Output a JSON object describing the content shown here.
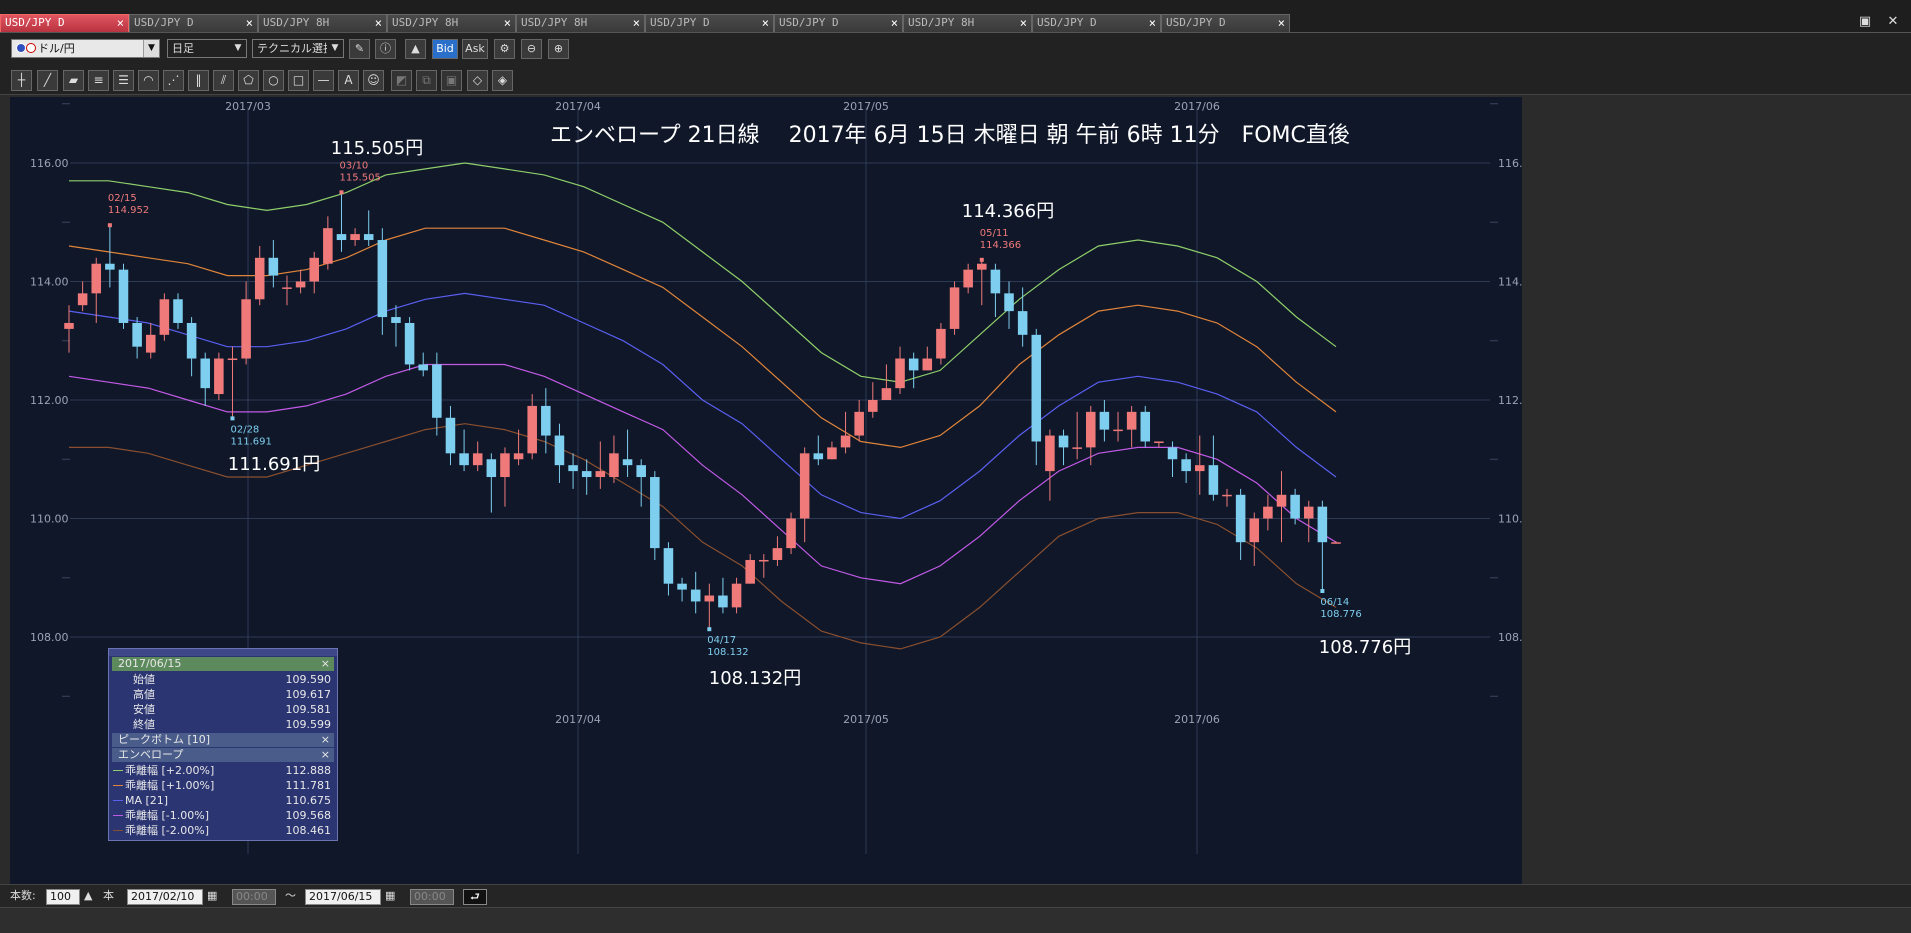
{
  "tabs": [
    {
      "label": "USD/JPY D",
      "active": true
    },
    {
      "label": "USD/JPY D",
      "active": false
    },
    {
      "label": "USD/JPY 8H",
      "active": false
    },
    {
      "label": "USD/JPY 8H",
      "active": false
    },
    {
      "label": "USD/JPY 8H",
      "active": false
    },
    {
      "label": "USD/JPY D",
      "active": false
    },
    {
      "label": "USD/JPY D",
      "active": false
    },
    {
      "label": "USD/JPY 8H",
      "active": false
    },
    {
      "label": "USD/JPY D",
      "active": false
    },
    {
      "label": "USD/JPY D",
      "active": false
    }
  ],
  "tab_close": "×",
  "window_buttons": [
    "▣",
    "✕"
  ],
  "toolbar": {
    "pair": "ドル/円",
    "timeframe": "日足",
    "technical": "テクニカル選択",
    "bid": "Bid",
    "ask": "Ask"
  },
  "chart": {
    "annotation": "エンベロープ 21日線　 2017年 6月 15日 木曜日 朝 午前 6時 11分　FOMC直後",
    "month_labels": [
      "2017/03",
      "2017/04",
      "2017/05",
      "2017/06"
    ],
    "y_labels": [
      "116.00",
      "114.00",
      "112.00",
      "110.00",
      "108.00"
    ],
    "price_callouts": [
      {
        "text": "115.505円"
      },
      {
        "text": "111.691円"
      },
      {
        "text": "114.366円"
      },
      {
        "text": "108.132円"
      },
      {
        "text": "108.776円"
      }
    ],
    "peak_labels": [
      {
        "date": "02/15",
        "price": "114.952",
        "kind": "high"
      },
      {
        "date": "03/10",
        "price": "115.505",
        "kind": "high"
      },
      {
        "date": "05/11",
        "price": "114.366",
        "kind": "high"
      },
      {
        "date": "02/28",
        "price": "111.691",
        "kind": "low"
      },
      {
        "date": "04/17",
        "price": "108.132",
        "kind": "low"
      },
      {
        "date": "06/14",
        "price": "108.776",
        "kind": "low"
      }
    ],
    "colors": {
      "up": "#f07a7a",
      "down": "#7ecfef",
      "plus2": "#8fcf6a",
      "plus1": "#e0843a",
      "ma": "#5a5ff0",
      "minus1": "#c25ae6",
      "minus2": "#8a4f2e"
    }
  },
  "chart_data": {
    "type": "candlestick",
    "ylim": [
      106.6,
      117.8
    ],
    "candles": [
      [
        113.2,
        113.3,
        112.8,
        113.6
      ],
      [
        113.6,
        113.8,
        113.5,
        114.0
      ],
      [
        113.8,
        114.3,
        113.3,
        114.4
      ],
      [
        114.3,
        114.2,
        113.9,
        114.95
      ],
      [
        114.2,
        113.3,
        113.2,
        114.3
      ],
      [
        113.3,
        112.9,
        112.7,
        113.4
      ],
      [
        112.8,
        113.1,
        112.7,
        113.3
      ],
      [
        113.1,
        113.7,
        113.0,
        113.8
      ],
      [
        113.7,
        113.3,
        113.2,
        113.8
      ],
      [
        113.3,
        112.7,
        112.4,
        113.4
      ],
      [
        112.7,
        112.2,
        111.9,
        112.8
      ],
      [
        112.1,
        112.7,
        112.0,
        112.8
      ],
      [
        112.7,
        112.7,
        111.69,
        112.9
      ],
      [
        112.7,
        113.7,
        112.6,
        114.0
      ],
      [
        113.7,
        114.4,
        113.6,
        114.6
      ],
      [
        114.4,
        114.1,
        113.9,
        114.7
      ],
      [
        113.9,
        113.9,
        113.6,
        114.1
      ],
      [
        113.9,
        114.0,
        113.8,
        114.2
      ],
      [
        114.0,
        114.4,
        113.8,
        114.5
      ],
      [
        114.3,
        114.9,
        114.2,
        115.1
      ],
      [
        114.8,
        114.7,
        114.5,
        115.505
      ],
      [
        114.7,
        114.8,
        114.6,
        114.9
      ],
      [
        114.8,
        114.7,
        114.6,
        115.2
      ],
      [
        114.7,
        113.4,
        113.1,
        114.9
      ],
      [
        113.4,
        113.3,
        112.9,
        113.6
      ],
      [
        113.3,
        112.6,
        112.5,
        113.4
      ],
      [
        112.6,
        112.5,
        112.4,
        112.8
      ],
      [
        112.6,
        111.7,
        111.4,
        112.8
      ],
      [
        111.7,
        111.1,
        110.9,
        111.9
      ],
      [
        111.1,
        110.9,
        110.8,
        111.5
      ],
      [
        110.9,
        111.1,
        110.8,
        111.3
      ],
      [
        111.0,
        110.7,
        110.1,
        111.1
      ],
      [
        110.7,
        111.1,
        110.2,
        111.2
      ],
      [
        111.0,
        111.1,
        110.9,
        111.5
      ],
      [
        111.1,
        111.9,
        111.0,
        112.1
      ],
      [
        111.9,
        111.4,
        111.1,
        112.2
      ],
      [
        111.4,
        110.9,
        110.6,
        111.6
      ],
      [
        110.9,
        110.8,
        110.5,
        111.1
      ],
      [
        110.8,
        110.7,
        110.4,
        111.0
      ],
      [
        110.7,
        110.8,
        110.5,
        111.3
      ],
      [
        110.7,
        111.1,
        110.6,
        111.4
      ],
      [
        111.0,
        110.9,
        110.7,
        111.5
      ],
      [
        110.9,
        110.7,
        110.2,
        111.0
      ],
      [
        110.7,
        109.5,
        109.3,
        110.8
      ],
      [
        109.5,
        108.9,
        108.7,
        109.6
      ],
      [
        108.9,
        108.8,
        108.6,
        109.0
      ],
      [
        108.8,
        108.6,
        108.4,
        109.1
      ],
      [
        108.6,
        108.7,
        108.132,
        108.9
      ],
      [
        108.7,
        108.5,
        108.4,
        109.0
      ],
      [
        108.5,
        108.9,
        108.4,
        109.0
      ],
      [
        108.9,
        109.3,
        108.9,
        109.4
      ],
      [
        109.3,
        109.3,
        109.0,
        109.4
      ],
      [
        109.3,
        109.5,
        109.2,
        109.7
      ],
      [
        109.5,
        110.0,
        109.4,
        110.1
      ],
      [
        110.0,
        111.1,
        109.6,
        111.2
      ],
      [
        111.1,
        111.0,
        110.9,
        111.4
      ],
      [
        111.0,
        111.2,
        111.0,
        111.3
      ],
      [
        111.2,
        111.4,
        111.1,
        111.8
      ],
      [
        111.4,
        111.8,
        111.3,
        112.0
      ],
      [
        111.8,
        112.0,
        111.7,
        112.3
      ],
      [
        112.0,
        112.2,
        112.0,
        112.6
      ],
      [
        112.2,
        112.7,
        112.1,
        112.9
      ],
      [
        112.7,
        112.5,
        112.2,
        112.8
      ],
      [
        112.5,
        112.7,
        112.5,
        112.9
      ],
      [
        112.7,
        113.2,
        112.6,
        113.3
      ],
      [
        113.2,
        113.9,
        113.1,
        114.0
      ],
      [
        113.9,
        114.2,
        113.8,
        114.3
      ],
      [
        114.2,
        114.3,
        113.6,
        114.366
      ],
      [
        114.2,
        113.8,
        113.4,
        114.3
      ],
      [
        113.8,
        113.5,
        113.2,
        114.0
      ],
      [
        113.5,
        113.1,
        112.9,
        113.9
      ],
      [
        113.1,
        111.3,
        110.9,
        113.2
      ],
      [
        110.8,
        111.4,
        110.3,
        111.5
      ],
      [
        111.4,
        111.2,
        110.9,
        111.5
      ],
      [
        111.2,
        111.2,
        111.0,
        111.8
      ],
      [
        111.2,
        111.8,
        110.9,
        111.9
      ],
      [
        111.8,
        111.5,
        111.3,
        112.0
      ],
      [
        111.5,
        111.5,
        111.3,
        111.8
      ],
      [
        111.5,
        111.8,
        111.2,
        111.9
      ],
      [
        111.8,
        111.3,
        111.2,
        111.9
      ],
      [
        111.3,
        111.3,
        111.2,
        111.3
      ],
      [
        111.2,
        111.0,
        110.7,
        111.3
      ],
      [
        111.0,
        110.8,
        110.6,
        111.1
      ],
      [
        110.8,
        110.9,
        110.4,
        111.4
      ],
      [
        110.9,
        110.4,
        110.3,
        111.4
      ],
      [
        110.4,
        110.4,
        110.2,
        110.5
      ],
      [
        110.4,
        109.6,
        109.3,
        110.5
      ],
      [
        109.6,
        110.0,
        109.2,
        110.1
      ],
      [
        110.0,
        110.2,
        109.8,
        110.4
      ],
      [
        110.2,
        110.4,
        109.6,
        110.8
      ],
      [
        110.4,
        110.0,
        109.9,
        110.5
      ],
      [
        110.0,
        110.2,
        109.6,
        110.3
      ],
      [
        110.2,
        109.6,
        108.776,
        110.3
      ],
      [
        109.59,
        109.599,
        109.581,
        109.617
      ]
    ],
    "env_plus2": [
      115.7,
      115.7,
      115.6,
      115.5,
      115.3,
      115.2,
      115.3,
      115.5,
      115.8,
      115.9,
      116.0,
      115.9,
      115.8,
      115.6,
      115.3,
      115.0,
      114.5,
      114.0,
      113.4,
      112.8,
      112.4,
      112.3,
      112.5,
      113.1,
      113.7,
      114.2,
      114.6,
      114.7,
      114.6,
      114.4,
      114.0,
      113.4,
      112.9
    ],
    "env_plus1": [
      114.6,
      114.5,
      114.4,
      114.3,
      114.1,
      114.1,
      114.2,
      114.4,
      114.7,
      114.9,
      114.9,
      114.9,
      114.7,
      114.5,
      114.2,
      113.9,
      113.4,
      112.9,
      112.3,
      111.7,
      111.3,
      111.2,
      111.4,
      111.9,
      112.6,
      113.1,
      113.5,
      113.6,
      113.5,
      113.3,
      112.9,
      112.3,
      111.8
    ],
    "ma": [
      113.5,
      113.4,
      113.3,
      113.1,
      112.9,
      112.9,
      113.0,
      113.2,
      113.5,
      113.7,
      113.8,
      113.7,
      113.6,
      113.3,
      113.0,
      112.6,
      112.0,
      111.6,
      111.0,
      110.4,
      110.1,
      110.0,
      110.3,
      110.8,
      111.4,
      111.9,
      112.3,
      112.4,
      112.3,
      112.1,
      111.8,
      111.2,
      110.7
    ],
    "env_minus1": [
      112.4,
      112.3,
      112.2,
      112.0,
      111.8,
      111.8,
      111.9,
      112.1,
      112.4,
      112.6,
      112.6,
      112.6,
      112.4,
      112.1,
      111.8,
      111.5,
      110.9,
      110.4,
      109.8,
      109.2,
      109.0,
      108.9,
      109.2,
      109.7,
      110.3,
      110.8,
      111.1,
      111.2,
      111.2,
      111.0,
      110.6,
      110.0,
      109.6
    ],
    "env_minus2": [
      111.2,
      111.2,
      111.1,
      110.9,
      110.7,
      110.7,
      110.9,
      111.1,
      111.3,
      111.5,
      111.6,
      111.5,
      111.3,
      111.0,
      110.6,
      110.2,
      109.6,
      109.2,
      108.6,
      108.1,
      107.9,
      107.8,
      108.0,
      108.5,
      109.1,
      109.7,
      110.0,
      110.1,
      110.1,
      109.9,
      109.5,
      108.9,
      108.5
    ]
  },
  "datawindow": {
    "date": "2017/06/15",
    "close_x": "×",
    "ohlc": [
      {
        "label": "始値",
        "value": "109.590"
      },
      {
        "label": "高値",
        "value": "109.617"
      },
      {
        "label": "安値",
        "value": "109.581"
      },
      {
        "label": "終値",
        "value": "109.599"
      }
    ],
    "peak_section": "ピークボトム [10]",
    "env_section": "エンベロープ",
    "env_rows": [
      {
        "label": "乖離幅 [+2.00%]",
        "value": "112.888",
        "color": "#8fcf6a"
      },
      {
        "label": "乖離幅 [+1.00%]",
        "value": "111.781",
        "color": "#e0843a"
      },
      {
        "label": "MA [21]",
        "value": "110.675",
        "color": "#5a5ff0"
      },
      {
        "label": "乖離幅 [-1.00%]",
        "value": "109.568",
        "color": "#c25ae6"
      },
      {
        "label": "乖離幅 [-2.00%]",
        "value": "108.461",
        "color": "#8a4f2e"
      }
    ]
  },
  "bottom": {
    "count_label": "本数:",
    "count_value": "100",
    "unit": "本",
    "from_date": "2017/02/10",
    "from_time": "00:00",
    "tilde": "〜",
    "to_date": "2017/06/15",
    "to_time": "00:00"
  }
}
